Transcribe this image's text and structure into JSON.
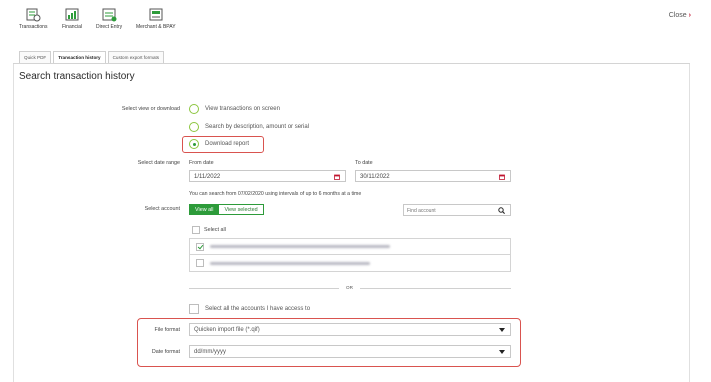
{
  "nav": {
    "items": [
      {
        "label": "Transactions",
        "icon": "transactions-icon"
      },
      {
        "label": "Financial",
        "icon": "financial-icon"
      },
      {
        "label": "Direct Entry",
        "icon": "direct-entry-icon"
      },
      {
        "label": "Merchant & BPAY",
        "icon": "merchant-bpay-icon"
      }
    ],
    "close_label": "Close",
    "close_chevron": "›"
  },
  "tabs": [
    {
      "label": "Quick PDF",
      "active": false
    },
    {
      "label": "Transaction history",
      "active": true
    },
    {
      "label": "Custom export formats",
      "active": false
    }
  ],
  "page_title": "Search transaction history",
  "view": {
    "label": "Select view or download",
    "options": [
      {
        "label": "View transactions on screen",
        "selected": false
      },
      {
        "label": "Search by description, amount or serial",
        "selected": false
      },
      {
        "label": "Download report",
        "selected": true
      }
    ]
  },
  "dates": {
    "label": "Select date range",
    "from_caption": "From date",
    "from_value": "1/11/2022",
    "to_caption": "To date",
    "to_value": "30/11/2022",
    "hint": "You can search from 07/02/2020 using intervals of up to 6 months at a time"
  },
  "accounts": {
    "label": "Select account",
    "view_all": "View all",
    "view_selected": "View selected",
    "find_placeholder": "Find account",
    "select_all": "Select all",
    "rows": [
      {
        "checked": true
      },
      {
        "checked": false
      }
    ],
    "or_text": "OR",
    "select_all_access": "Select all the accounts I have access to"
  },
  "file_format": {
    "label": "File format",
    "value": "Quicken import file (*.qif)"
  },
  "date_format": {
    "label": "Date format",
    "value": "dd/mm/yyyy"
  },
  "colors": {
    "brand_green": "#2d9b3a",
    "highlight_red": "#d9534f",
    "close_red": "#c0152f"
  }
}
